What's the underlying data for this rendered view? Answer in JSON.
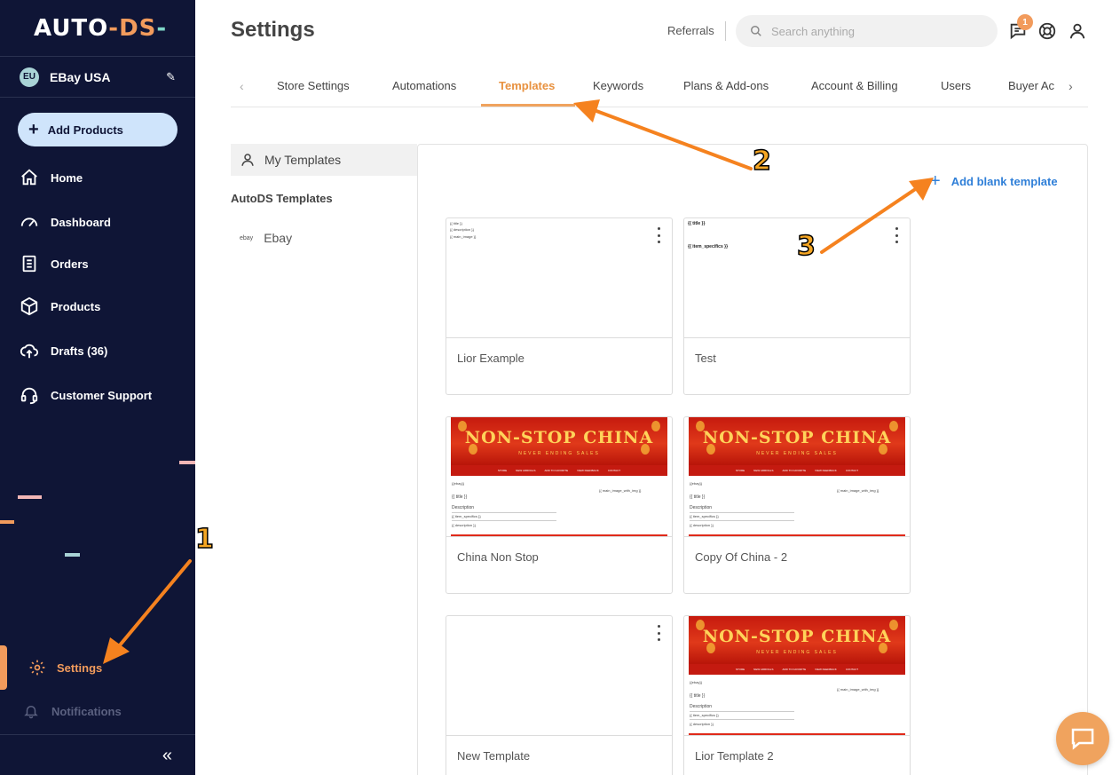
{
  "sidebar": {
    "logo": {
      "part1": "AUT",
      "part2": "O",
      "part3": "-DS",
      "part4": "-"
    },
    "store": {
      "badge": "EU",
      "name": "EBay USA"
    },
    "add_products": "Add Products",
    "nav": [
      {
        "label": "Home",
        "icon": "home-icon"
      },
      {
        "label": "Dashboard",
        "icon": "gauge-icon"
      },
      {
        "label": "Orders",
        "icon": "clipboard-icon"
      },
      {
        "label": "Products",
        "icon": "box-icon"
      },
      {
        "label": "Drafts (36)",
        "icon": "cloud-upload-icon"
      },
      {
        "label": "Customer Support",
        "icon": "headset-icon"
      }
    ],
    "settings": "Settings",
    "notifications": "Notifications",
    "collapse": "«"
  },
  "header": {
    "title": "Settings",
    "referrals": "Referrals",
    "search_placeholder": "Search anything",
    "chat_badge": "1"
  },
  "tabs": [
    "Store Settings",
    "Automations",
    "Templates",
    "Keywords",
    "Plans & Add-ons",
    "Account & Billing",
    "Users",
    "Buyer Ac"
  ],
  "active_tab": "Templates",
  "left_nav": {
    "my_templates": "My Templates",
    "section": "AutoDS Templates",
    "ebay_logo": "ebay",
    "ebay": "Ebay"
  },
  "add_blank_template": "Add blank template",
  "templates": [
    {
      "name": "Lior Example",
      "preview": [
        "{{ title }}",
        "{{ description }}",
        "{{ main_image }}"
      ]
    },
    {
      "name": "Test",
      "preview": [
        "{{ title }}",
        "{{ item_specifics }}"
      ]
    },
    {
      "name": "China Non Stop",
      "preview": "china"
    },
    {
      "name": "Copy Of China - 2",
      "preview": "china"
    },
    {
      "name": "New Template",
      "preview": "blank"
    },
    {
      "name": "Lior Template 2",
      "preview": "china"
    }
  ],
  "china_preview": {
    "title": "NON-STOP CHINA",
    "subtitle": "NEVER ENDING SALES",
    "nav": [
      "STORE",
      "NEW ARRIVALS",
      "ADD TO FAVORITE",
      "VIEW FEEDBACK",
      "CONTACT"
    ],
    "ebay": "{{ebay}}",
    "title_var": "{{ title }}",
    "desc": "Description",
    "specifics": "{{ item_specifics }}",
    "desc_var": "{{ description }}",
    "image_var": "{{ main_image_with_img }}"
  },
  "annotations": {
    "step1": "1",
    "step2": "2",
    "step3": "3"
  },
  "colors": {
    "sidebar_bg": "#0f1536",
    "accent": "#f29b5c",
    "link": "#2f7fd8"
  }
}
